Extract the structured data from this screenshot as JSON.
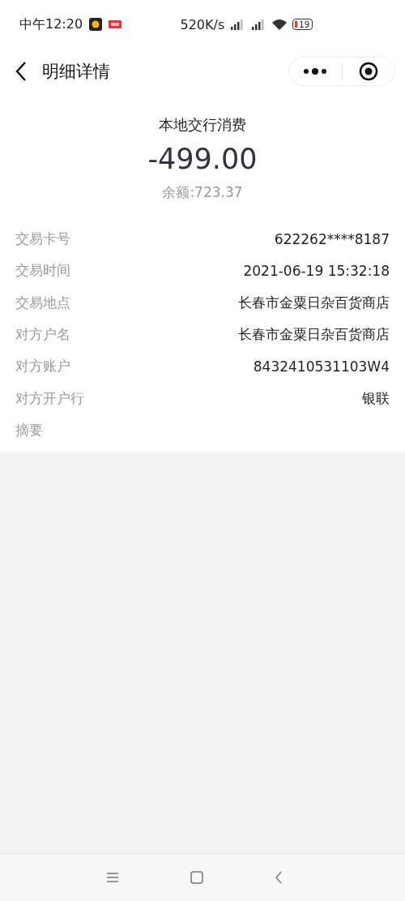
{
  "status_bar": {
    "time": "中午12:20",
    "speed": "520K/s",
    "battery": "19"
  },
  "header": {
    "title": "明细详情"
  },
  "summary": {
    "title": "本地交行消费",
    "amount": "-499.00",
    "balance": "余额:723.37"
  },
  "details": [
    {
      "label": "交易卡号",
      "value": "622262****8187"
    },
    {
      "label": "交易时间",
      "value": "2021-06-19 15:32:18"
    },
    {
      "label": "交易地点",
      "value": "长春市金粟日杂百货商店"
    },
    {
      "label": "对方户名",
      "value": "长春市金粟日杂百货商店"
    },
    {
      "label": "对方账户",
      "value": "8432410531103W4"
    },
    {
      "label": "对方开户行",
      "value": "银联"
    },
    {
      "label": "摘要"
    }
  ]
}
